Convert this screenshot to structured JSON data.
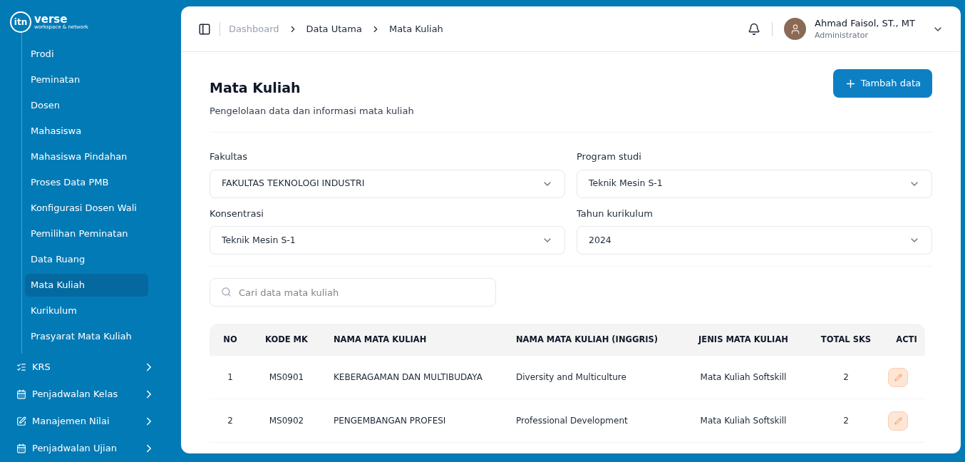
{
  "logo": {
    "mark": "itn",
    "name": "verse",
    "tagline": "workspace & network"
  },
  "sidebar": {
    "sub_items": [
      {
        "label": "Prodi",
        "selected": false
      },
      {
        "label": "Peminatan",
        "selected": false
      },
      {
        "label": "Dosen",
        "selected": false
      },
      {
        "label": "Mahasiswa",
        "selected": false
      },
      {
        "label": "Mahasiswa Pindahan",
        "selected": false
      },
      {
        "label": "Proses Data PMB",
        "selected": false
      },
      {
        "label": "Konfigurasi Dosen Wali",
        "selected": false
      },
      {
        "label": "Pemilihan Peminatan",
        "selected": false
      },
      {
        "label": "Data Ruang",
        "selected": false
      },
      {
        "label": "Mata Kuliah",
        "selected": true
      },
      {
        "label": "Kurikulum",
        "selected": false
      },
      {
        "label": "Prasyarat Mata Kuliah",
        "selected": false
      }
    ],
    "groups": [
      {
        "label": "KRS"
      },
      {
        "label": "Penjadwalan Kelas"
      },
      {
        "label": "Manajemen Nilai"
      },
      {
        "label": "Penjadwalan Ujian"
      }
    ]
  },
  "breadcrumb": [
    {
      "label": "Dashboard",
      "current": false
    },
    {
      "label": "Data Utama",
      "current": true
    },
    {
      "label": "Mata Kuliah",
      "current": true
    }
  ],
  "user": {
    "name": "Ahmad Faisol, ST., MT",
    "role": "Administrator"
  },
  "page": {
    "title": "Mata Kuliah",
    "subtitle": "Pengelolaan data dan informasi mata kuliah",
    "add_button": "Tambah data"
  },
  "filters": [
    {
      "label": "Fakultas",
      "value": "FAKULTAS TEKNOLOGI INDUSTRI"
    },
    {
      "label": "Program studi",
      "value": "Teknik Mesin S-1"
    },
    {
      "label": "Konsentrasi",
      "value": "Teknik Mesin S-1"
    },
    {
      "label": "Tahun kurikulum",
      "value": "2024"
    }
  ],
  "search": {
    "placeholder": "Cari data mata kuliah"
  },
  "table": {
    "columns": [
      "NO",
      "KODE MK",
      "NAMA MATA KULIAH",
      "NAMA MATA KULIAH (INGGRIS)",
      "JENIS MATA KULIAH",
      "TOTAL SKS",
      "ACTI"
    ],
    "rows": [
      {
        "no": "1",
        "code": "MS0901",
        "name": "KEBERAGAMAN DAN MULTIBUDAYA",
        "name_en": "Diversity and Multiculture",
        "type": "Mata Kuliah Softskill",
        "sks": "2"
      },
      {
        "no": "2",
        "code": "MS0902",
        "name": "PENGEMBANGAN PROFESI",
        "name_en": "Professional Development",
        "type": "Mata Kuliah Softskill",
        "sks": "2"
      }
    ]
  }
}
